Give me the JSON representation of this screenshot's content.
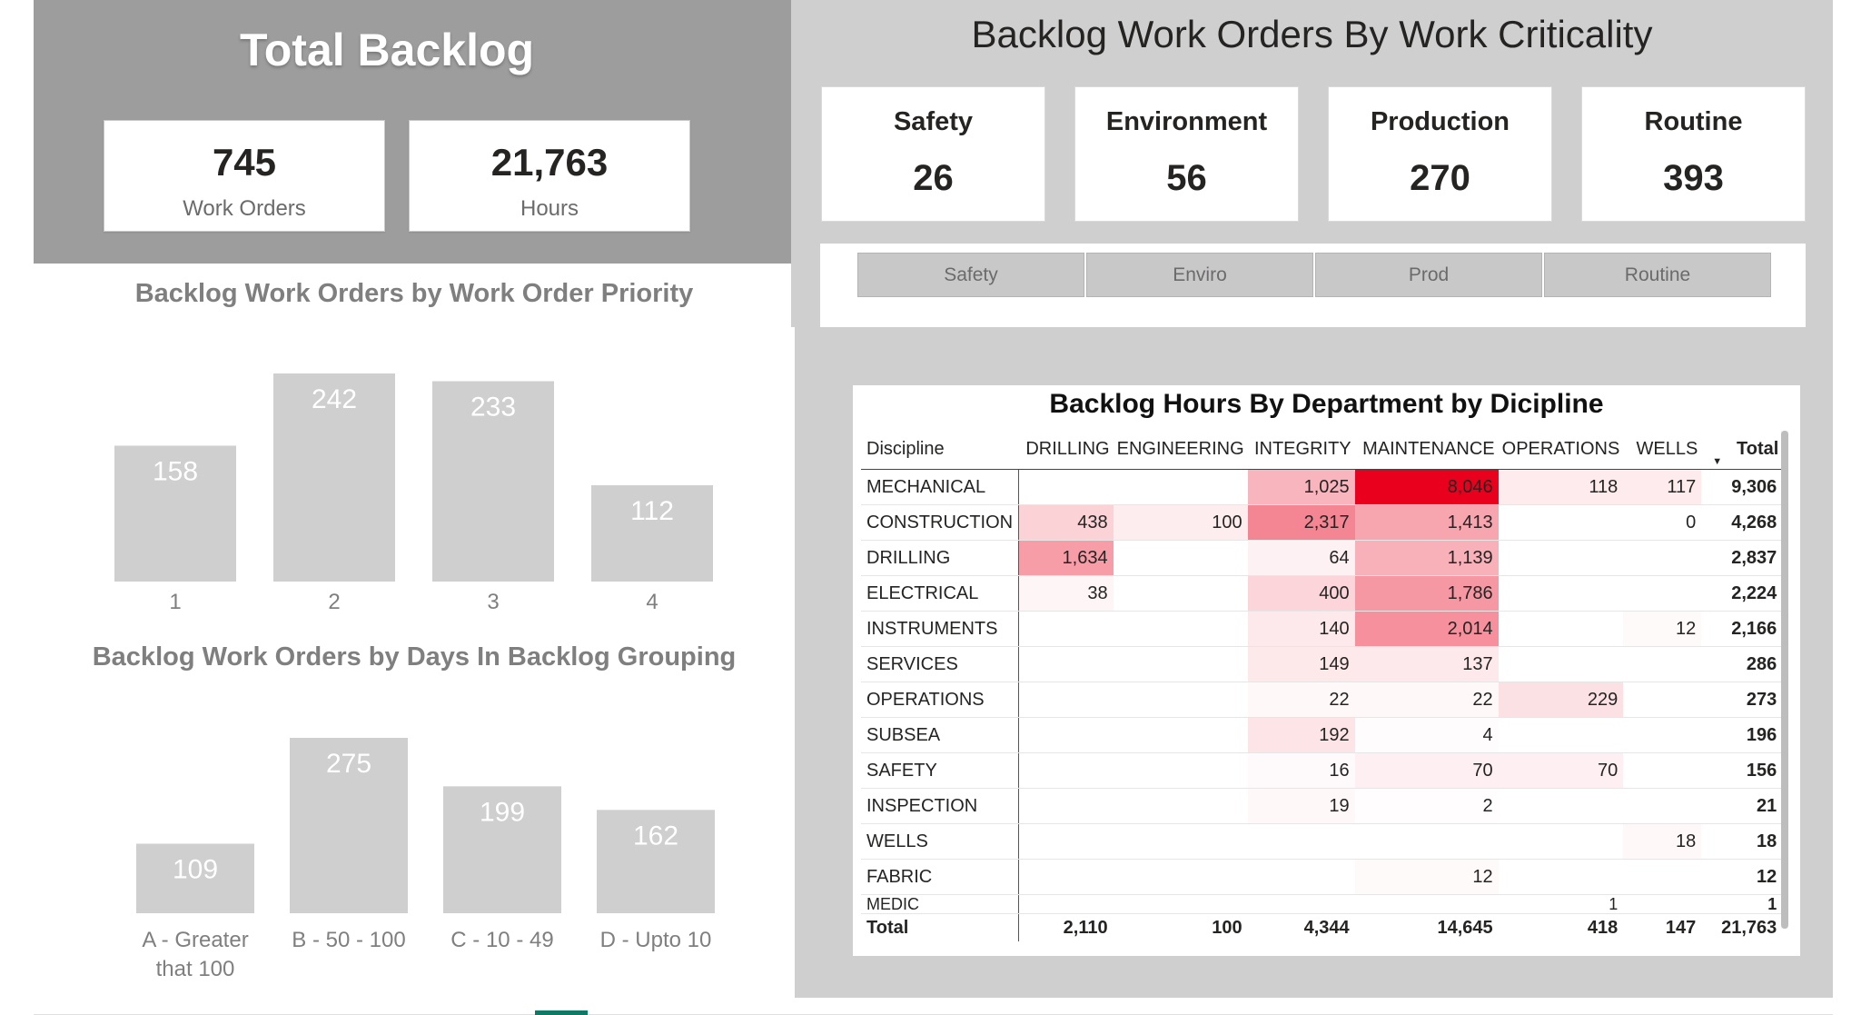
{
  "total_backlog": {
    "title": "Total Backlog",
    "work_orders": {
      "value": "745",
      "label": "Work Orders"
    },
    "hours": {
      "value": "21,763",
      "label": "Hours"
    }
  },
  "criticality": {
    "title": "Backlog Work Orders By Work Criticality",
    "cards": [
      {
        "label": "Safety",
        "value": "26"
      },
      {
        "label": "Environment",
        "value": "56"
      },
      {
        "label": "Production",
        "value": "270"
      },
      {
        "label": "Routine",
        "value": "393"
      }
    ],
    "buttons": [
      "Safety",
      "Enviro",
      "Prod",
      "Routine"
    ]
  },
  "chart_data": [
    {
      "type": "bar",
      "title": "Backlog Work Orders by Work Order Priority",
      "categories": [
        "1",
        "2",
        "3",
        "4"
      ],
      "values": [
        158,
        242,
        233,
        112
      ],
      "ylim": [
        0,
        242
      ],
      "bar_color": "#d0cfd0",
      "label_color": "#ffffff",
      "grid": false
    },
    {
      "type": "bar",
      "title": "Backlog Work Orders by Days In Backlog Grouping",
      "categories": [
        [
          "A - Greater",
          "that 100"
        ],
        [
          "B - 50 - 100"
        ],
        [
          "C - 10 - 49"
        ],
        [
          "D - Upto 10"
        ]
      ],
      "values": [
        109,
        275,
        199,
        162
      ],
      "ylim": [
        0,
        275
      ],
      "bar_color": "#d0cfd0",
      "label_color": "#ffffff",
      "grid": false
    },
    {
      "type": "table",
      "title": "Backlog Hours By Department by Dicipline",
      "columns": [
        "Discipline",
        "DRILLING",
        "ENGINEERING",
        "INTEGRITY",
        "MAINTENANCE",
        "OPERATIONS",
        "WELLS",
        "Total"
      ],
      "sorted_column": "Total",
      "max_value": 8046,
      "heat_color": "#e8001c",
      "rows": [
        {
          "discipline": "MECHANICAL",
          "values": [
            null,
            null,
            1025,
            8046,
            118,
            117,
            9306
          ],
          "display": [
            "",
            "",
            "1,025",
            "8,046",
            "118",
            "117",
            "9,306"
          ]
        },
        {
          "discipline": "CONSTRUCTION",
          "values": [
            438,
            100,
            2317,
            1413,
            null,
            0,
            4268
          ],
          "display": [
            "438",
            "100",
            "2,317",
            "1,413",
            "",
            "0",
            "4,268"
          ]
        },
        {
          "discipline": "DRILLING",
          "values": [
            1634,
            null,
            64,
            1139,
            null,
            null,
            2837
          ],
          "display": [
            "1,634",
            "",
            "64",
            "1,139",
            "",
            "",
            "2,837"
          ]
        },
        {
          "discipline": "ELECTRICAL",
          "values": [
            38,
            null,
            400,
            1786,
            null,
            null,
            2224
          ],
          "display": [
            "38",
            "",
            "400",
            "1,786",
            "",
            "",
            "2,224"
          ]
        },
        {
          "discipline": "INSTRUMENTS",
          "values": [
            null,
            null,
            140,
            2014,
            null,
            12,
            2166
          ],
          "display": [
            "",
            "",
            "140",
            "2,014",
            "",
            "12",
            "2,166"
          ]
        },
        {
          "discipline": "SERVICES",
          "values": [
            null,
            null,
            149,
            137,
            null,
            null,
            286
          ],
          "display": [
            "",
            "",
            "149",
            "137",
            "",
            "",
            "286"
          ]
        },
        {
          "discipline": "OPERATIONS",
          "values": [
            null,
            null,
            22,
            22,
            229,
            null,
            273
          ],
          "display": [
            "",
            "",
            "22",
            "22",
            "229",
            "",
            "273"
          ]
        },
        {
          "discipline": "SUBSEA",
          "values": [
            null,
            null,
            192,
            4,
            null,
            null,
            196
          ],
          "display": [
            "",
            "",
            "192",
            "4",
            "",
            "",
            "196"
          ]
        },
        {
          "discipline": "SAFETY",
          "values": [
            null,
            null,
            16,
            70,
            70,
            null,
            156
          ],
          "display": [
            "",
            "",
            "16",
            "70",
            "70",
            "",
            "156"
          ]
        },
        {
          "discipline": "INSPECTION",
          "values": [
            null,
            null,
            19,
            2,
            null,
            null,
            21
          ],
          "display": [
            "",
            "",
            "19",
            "2",
            "",
            "",
            "21"
          ]
        },
        {
          "discipline": "WELLS",
          "values": [
            null,
            null,
            null,
            null,
            null,
            18,
            18
          ],
          "display": [
            "",
            "",
            "",
            "",
            "",
            "18",
            "18"
          ]
        },
        {
          "discipline": "FABRIC",
          "values": [
            null,
            null,
            null,
            12,
            null,
            null,
            12
          ],
          "display": [
            "",
            "",
            "",
            "12",
            "",
            "",
            "12"
          ]
        },
        {
          "discipline": "MEDIC",
          "values": [
            null,
            null,
            null,
            null,
            1,
            null,
            1
          ],
          "display": [
            "",
            "",
            "",
            "",
            "1",
            "",
            "1"
          ],
          "clipped": true
        }
      ],
      "totals": {
        "label": "Total",
        "values": [
          2110,
          100,
          4344,
          14645,
          418,
          147,
          21763
        ],
        "display": [
          "2,110",
          "100",
          "4,344",
          "14,645",
          "418",
          "147",
          "21,763"
        ]
      }
    }
  ]
}
